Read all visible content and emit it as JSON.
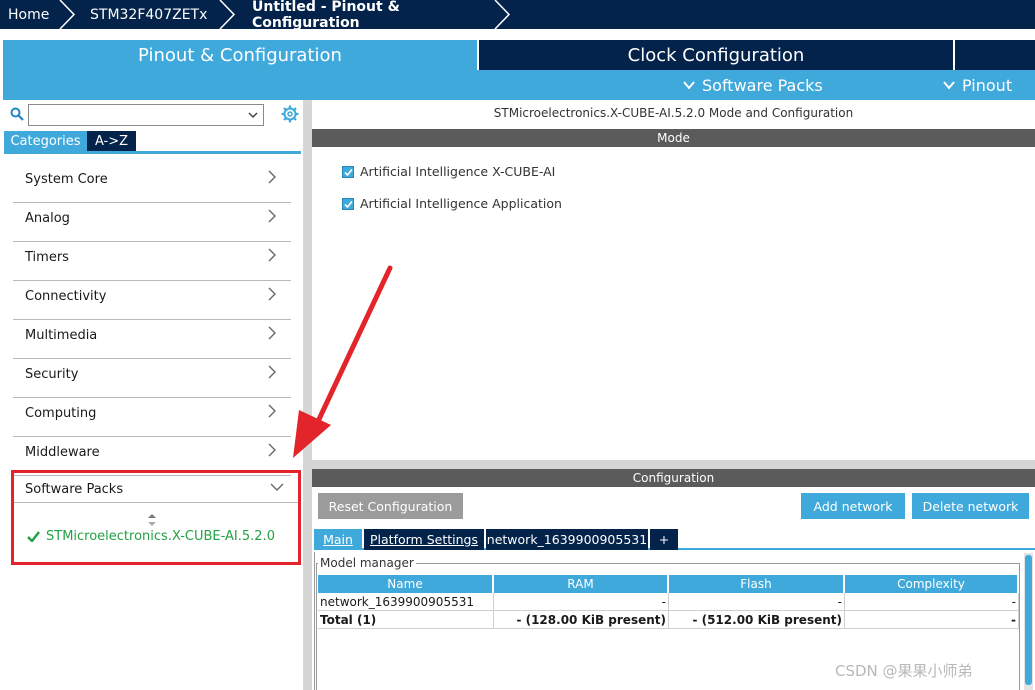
{
  "breadcrumbs": [
    "Home",
    "STM32F407ZETx",
    "Untitled - Pinout & Configuration"
  ],
  "top_tabs": {
    "pinout": "Pinout & Configuration",
    "clock": "Clock Configuration"
  },
  "sub_menu": {
    "software_packs": "Software Packs",
    "pinout": "Pinout"
  },
  "left": {
    "search_value": "",
    "tabs": [
      "Categories",
      "A->Z"
    ],
    "categories": [
      "System Core",
      "Analog",
      "Timers",
      "Connectivity",
      "Multimedia",
      "Security",
      "Computing",
      "Middleware"
    ],
    "software_packs": {
      "label": "Software Packs",
      "item": "STMicroelectronics.X-CUBE-AI.5.2.0"
    }
  },
  "right": {
    "title": "STMicroelectronics.X-CUBE-AI.5.2.0 Mode and Configuration",
    "mode_label": "Mode",
    "mode_options": [
      {
        "label": "Artificial Intelligence X-CUBE-AI",
        "checked": true
      },
      {
        "label": "Artificial Intelligence Application",
        "checked": true
      }
    ],
    "config_label": "Configuration",
    "buttons": {
      "reset": "Reset Configuration",
      "add": "Add network",
      "delete": "Delete network"
    },
    "tabs": [
      "Main",
      "Platform Settings",
      "network_1639900905531",
      "+"
    ],
    "model_manager": {
      "legend": "Model manager",
      "headers": [
        "Name",
        "RAM",
        "Flash",
        "Complexity"
      ],
      "rows": [
        [
          "network_1639900905531",
          "-",
          "-",
          "-"
        ],
        [
          "Total (1)",
          "- (128.00 KiB present)",
          "- (512.00 KiB present)",
          "-"
        ]
      ]
    }
  },
  "watermark": "CSDN @果果小师弟",
  "colors": {
    "navy": "#03234b",
    "accent": "#3fa9dc",
    "annotation": "#e3242b",
    "pack_green": "#23a044"
  }
}
